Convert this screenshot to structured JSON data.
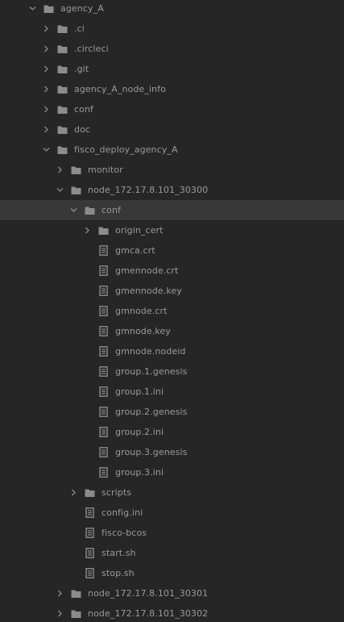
{
  "tree": [
    {
      "label": "agency_A",
      "type": "folder",
      "depth": 0,
      "expanded": true
    },
    {
      "label": ".ci",
      "type": "folder",
      "depth": 1,
      "expanded": false
    },
    {
      "label": ".circleci",
      "type": "folder",
      "depth": 1,
      "expanded": false
    },
    {
      "label": ".git",
      "type": "folder",
      "depth": 1,
      "expanded": false
    },
    {
      "label": "agency_A_node_info",
      "type": "folder",
      "depth": 1,
      "expanded": false
    },
    {
      "label": "conf",
      "type": "folder",
      "depth": 1,
      "expanded": false
    },
    {
      "label": "doc",
      "type": "folder",
      "depth": 1,
      "expanded": false
    },
    {
      "label": "fisco_deploy_agency_A",
      "type": "folder",
      "depth": 1,
      "expanded": true
    },
    {
      "label": "monitor",
      "type": "folder",
      "depth": 2,
      "expanded": false
    },
    {
      "label": "node_172.17.8.101_30300",
      "type": "folder",
      "depth": 2,
      "expanded": true
    },
    {
      "label": "conf",
      "type": "folder",
      "depth": 3,
      "expanded": true,
      "selected": true
    },
    {
      "label": "origin_cert",
      "type": "folder",
      "depth": 4,
      "expanded": false
    },
    {
      "label": "gmca.crt",
      "type": "file",
      "depth": 4
    },
    {
      "label": "gmennode.crt",
      "type": "file",
      "depth": 4
    },
    {
      "label": "gmennode.key",
      "type": "file",
      "depth": 4
    },
    {
      "label": "gmnode.crt",
      "type": "file",
      "depth": 4
    },
    {
      "label": "gmnode.key",
      "type": "file",
      "depth": 4
    },
    {
      "label": "gmnode.nodeid",
      "type": "file",
      "depth": 4
    },
    {
      "label": "group.1.genesis",
      "type": "file",
      "depth": 4
    },
    {
      "label": "group.1.ini",
      "type": "file",
      "depth": 4
    },
    {
      "label": "group.2.genesis",
      "type": "file",
      "depth": 4
    },
    {
      "label": "group.2.ini",
      "type": "file",
      "depth": 4
    },
    {
      "label": "group.3.genesis",
      "type": "file",
      "depth": 4
    },
    {
      "label": "group.3.ini",
      "type": "file",
      "depth": 4
    },
    {
      "label": "scripts",
      "type": "folder",
      "depth": 3,
      "expanded": false
    },
    {
      "label": "config.ini",
      "type": "file",
      "depth": 3
    },
    {
      "label": "fisco-bcos",
      "type": "file",
      "depth": 3
    },
    {
      "label": "start.sh",
      "type": "file",
      "depth": 3
    },
    {
      "label": "stop.sh",
      "type": "file",
      "depth": 3
    },
    {
      "label": "node_172.17.8.101_30301",
      "type": "folder",
      "depth": 2,
      "expanded": false
    },
    {
      "label": "node_172.17.8.101_30302",
      "type": "folder",
      "depth": 2,
      "expanded": false
    }
  ],
  "colors": {
    "background": "#262626",
    "selected_row": "#383838",
    "text": "#9a9a9a",
    "icon": "#8c8c8c"
  },
  "icons": {
    "folder": "folder-icon",
    "file": "file-icon",
    "expanded": "chevron-down-icon",
    "collapsed": "chevron-right-icon"
  }
}
